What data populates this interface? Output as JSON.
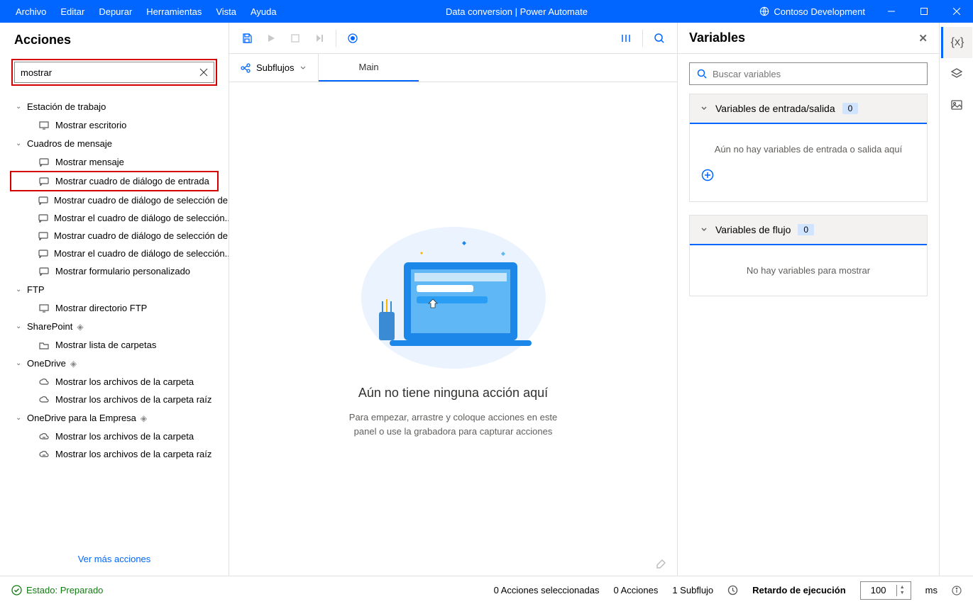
{
  "titlebar": {
    "menus": [
      "Archivo",
      "Editar",
      "Depurar",
      "Herramientas",
      "Vista",
      "Ayuda"
    ],
    "title": "Data conversion | Power Automate",
    "env": "Contoso Development"
  },
  "actions": {
    "title": "Acciones",
    "search_value": "mostrar",
    "see_more": "Ver más acciones",
    "groups": [
      {
        "label": "Estación de trabajo",
        "premium": false,
        "items": [
          {
            "icon": "desktop",
            "label": "Mostrar escritorio"
          }
        ]
      },
      {
        "label": "Cuadros de mensaje",
        "premium": false,
        "items": [
          {
            "icon": "msg",
            "label": "Mostrar mensaje"
          },
          {
            "icon": "msg",
            "label": "Mostrar cuadro de diálogo de entrada",
            "highlight": true
          },
          {
            "icon": "msg",
            "label": "Mostrar cuadro de diálogo de selección de..."
          },
          {
            "icon": "msg",
            "label": "Mostrar el cuadro de diálogo de selección..."
          },
          {
            "icon": "msg",
            "label": "Mostrar cuadro de diálogo de selección de..."
          },
          {
            "icon": "msg",
            "label": "Mostrar el cuadro de diálogo de selección..."
          },
          {
            "icon": "msg",
            "label": "Mostrar formulario personalizado"
          }
        ]
      },
      {
        "label": "FTP",
        "premium": false,
        "items": [
          {
            "icon": "desktop",
            "label": "Mostrar directorio FTP"
          }
        ]
      },
      {
        "label": "SharePoint",
        "premium": true,
        "items": [
          {
            "icon": "folder",
            "label": "Mostrar lista de carpetas"
          }
        ]
      },
      {
        "label": "OneDrive",
        "premium": true,
        "items": [
          {
            "icon": "cloud",
            "label": "Mostrar los archivos de la carpeta"
          },
          {
            "icon": "cloud",
            "label": "Mostrar los archivos de la carpeta raíz"
          }
        ]
      },
      {
        "label": "OneDrive para la Empresa",
        "premium": true,
        "items": [
          {
            "icon": "cloud2",
            "label": "Mostrar los archivos de la carpeta"
          },
          {
            "icon": "cloud2",
            "label": "Mostrar los archivos de la carpeta raíz"
          }
        ]
      }
    ]
  },
  "subflows": {
    "btn": "Subflujos",
    "tab": "Main"
  },
  "canvas": {
    "title": "Aún no tiene ninguna acción aquí",
    "subtitle": "Para empezar, arrastre y coloque acciones en este panel o use la grabadora para capturar acciones"
  },
  "variables": {
    "title": "Variables",
    "search_ph": "Buscar variables",
    "sections": [
      {
        "label": "Variables de entrada/salida",
        "count": "0",
        "empty": "Aún no hay variables de entrada o salida aquí",
        "plus": true
      },
      {
        "label": "Variables de flujo",
        "count": "0",
        "empty": "No hay variables para mostrar",
        "plus": false
      }
    ]
  },
  "status": {
    "state": "Estado: Preparado",
    "sel": "0 Acciones seleccionadas",
    "act": "0 Acciones",
    "sub": "1 Subflujo",
    "delay_lbl": "Retardo de ejecución",
    "delay_val": "100",
    "ms": "ms"
  }
}
